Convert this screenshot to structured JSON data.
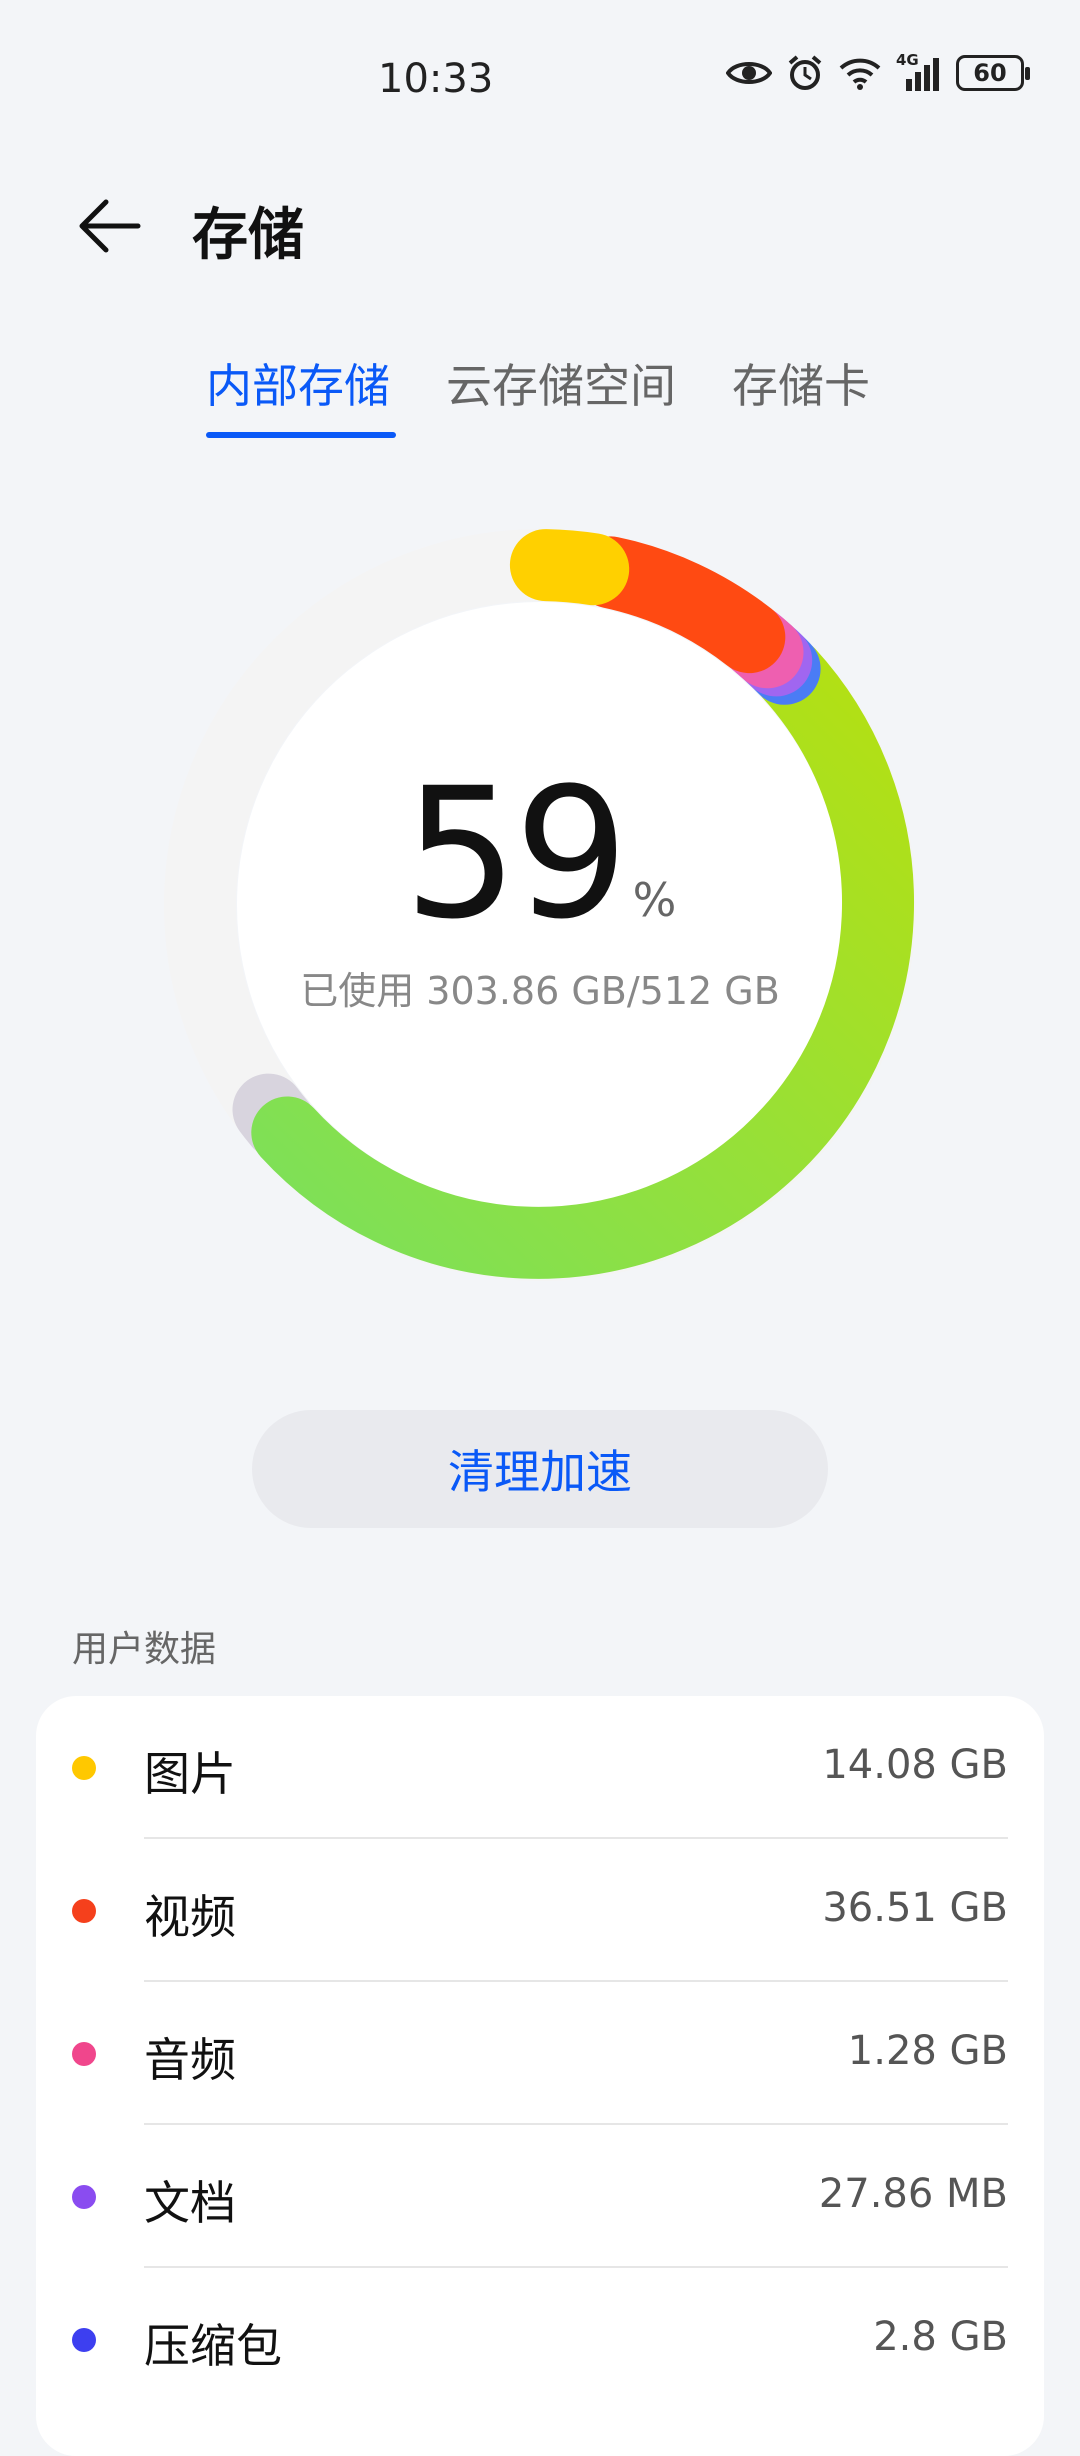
{
  "status_bar": {
    "time": "10:33",
    "icons": [
      "eye-icon",
      "alarm-icon",
      "wifi-icon",
      "signal-4g-icon",
      "battery-icon"
    ],
    "network": "4G",
    "battery": "60"
  },
  "header": {
    "title": "存储",
    "back_icon": "back-arrow-icon"
  },
  "tabs": [
    {
      "label": "内部存储",
      "active": true
    },
    {
      "label": "云存储空间",
      "active": false
    },
    {
      "label": "存储卡",
      "active": false
    }
  ],
  "usage": {
    "percent": "59",
    "percent_sign": "%",
    "used_text": "已使用 303.86 GB/512 GB",
    "used_fraction": 0.59
  },
  "clean_button": {
    "label": "清理加速"
  },
  "user_data": {
    "section_label": "用户数据",
    "items": [
      {
        "name": "图片",
        "size": "14.08 GB",
        "color": "#ffc800"
      },
      {
        "name": "视频",
        "size": "36.51 GB",
        "color": "#f5401c"
      },
      {
        "name": "音频",
        "size": "1.28 GB",
        "color": "#f0468c"
      },
      {
        "name": "文档",
        "size": "27.86 MB",
        "color": "#8a4cf0"
      },
      {
        "name": "压缩包",
        "size": "2.8 GB",
        "color": "#3d3ff0"
      }
    ]
  },
  "colors": {
    "accent": "#0a59f7",
    "ring_green_start": "#7ce05a",
    "ring_green_end": "#b4e012",
    "ring_background": "#f4f4f4",
    "ring_system": "#d8d4de"
  }
}
